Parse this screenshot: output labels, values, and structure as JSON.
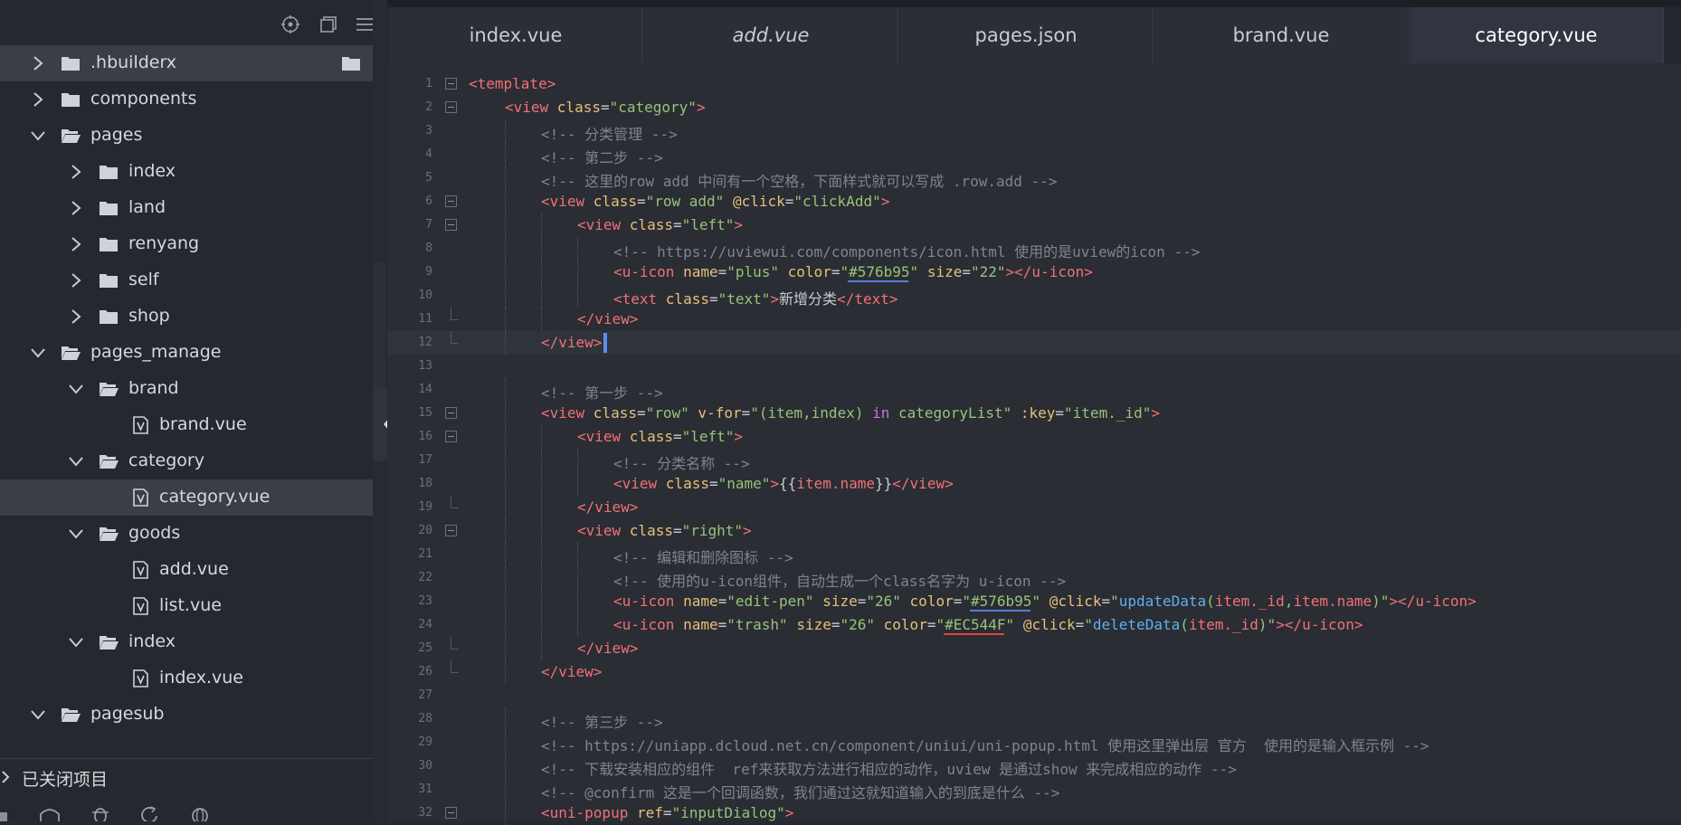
{
  "sidebar": {
    "tree": [
      {
        "label": ".hbuilderx",
        "type": "folder",
        "depth": 0,
        "state": "collapsed",
        "selected": true
      },
      {
        "label": "components",
        "type": "folder",
        "depth": 0,
        "state": "collapsed"
      },
      {
        "label": "pages",
        "type": "folder",
        "depth": 0,
        "state": "expanded"
      },
      {
        "label": "index",
        "type": "folder",
        "depth": 1,
        "state": "collapsed"
      },
      {
        "label": "land",
        "type": "folder",
        "depth": 1,
        "state": "collapsed"
      },
      {
        "label": "renyang",
        "type": "folder",
        "depth": 1,
        "state": "collapsed"
      },
      {
        "label": "self",
        "type": "folder",
        "depth": 1,
        "state": "collapsed"
      },
      {
        "label": "shop",
        "type": "folder",
        "depth": 1,
        "state": "collapsed"
      },
      {
        "label": "pages_manage",
        "type": "folder",
        "depth": 0,
        "state": "expanded"
      },
      {
        "label": "brand",
        "type": "folder",
        "depth": 1,
        "state": "expanded"
      },
      {
        "label": "brand.vue",
        "type": "file",
        "depth": 2
      },
      {
        "label": "category",
        "type": "folder",
        "depth": 1,
        "state": "expanded"
      },
      {
        "label": "category.vue",
        "type": "file",
        "depth": 2,
        "selected": true
      },
      {
        "label": "goods",
        "type": "folder",
        "depth": 1,
        "state": "expanded"
      },
      {
        "label": "add.vue",
        "type": "file",
        "depth": 2
      },
      {
        "label": "list.vue",
        "type": "file",
        "depth": 2
      },
      {
        "label": "index",
        "type": "folder",
        "depth": 1,
        "state": "expanded"
      },
      {
        "label": "index.vue",
        "type": "file",
        "depth": 2
      },
      {
        "label": "pagesub",
        "type": "folder",
        "depth": 0,
        "state": "expanded"
      }
    ],
    "closed_projects_label": "已关闭项目"
  },
  "tabs": [
    {
      "label": "index.vue",
      "italic": false,
      "active": false
    },
    {
      "label": "add.vue",
      "italic": true,
      "active": false
    },
    {
      "label": "pages.json",
      "italic": false,
      "active": false
    },
    {
      "label": "brand.vue",
      "italic": false,
      "active": false
    },
    {
      "label": "category.vue",
      "italic": false,
      "active": true
    }
  ],
  "colors": {
    "background": "#272a30",
    "tag": "#f07178",
    "attribute": "#e6c07b",
    "string": "#98c379",
    "comment": "#7f848e",
    "keyword": "#c678dd",
    "function": "#61afef",
    "underline_blue": "#5b7bd5",
    "underline_red": "#e0443e"
  },
  "code": {
    "current_line": 12,
    "lines": [
      {
        "n": "1",
        "indent": 0,
        "fold": "open",
        "tokens": [
          [
            "t",
            "<template>"
          ]
        ]
      },
      {
        "n": "2",
        "indent": 1,
        "fold": "open",
        "tokens": [
          [
            "t",
            "<view "
          ],
          [
            "a",
            "class"
          ],
          [
            "p",
            "="
          ],
          [
            "s",
            "\"category\""
          ],
          [
            "t",
            ">"
          ]
        ]
      },
      {
        "n": "3",
        "indent": 2,
        "tokens": [
          [
            "c",
            "<!-- 分类管理 -->"
          ]
        ]
      },
      {
        "n": "4",
        "indent": 2,
        "tokens": [
          [
            "c",
            "<!-- 第二步 -->"
          ]
        ]
      },
      {
        "n": "5",
        "indent": 2,
        "tokens": [
          [
            "c",
            "<!-- 这里的row add 中间有一个空格，下面样式就可以写成 .row.add -->"
          ]
        ]
      },
      {
        "n": "6",
        "indent": 2,
        "fold": "open",
        "tokens": [
          [
            "t",
            "<view "
          ],
          [
            "a",
            "class"
          ],
          [
            "p",
            "="
          ],
          [
            "s",
            "\"row add\""
          ],
          [
            "p",
            " "
          ],
          [
            "a",
            "@click"
          ],
          [
            "p",
            "="
          ],
          [
            "s",
            "\"clickAdd\""
          ],
          [
            "t",
            ">"
          ]
        ]
      },
      {
        "n": "7",
        "indent": 3,
        "fold": "open",
        "tokens": [
          [
            "t",
            "<view "
          ],
          [
            "a",
            "class"
          ],
          [
            "p",
            "="
          ],
          [
            "s",
            "\"left\""
          ],
          [
            "t",
            ">"
          ]
        ]
      },
      {
        "n": "8",
        "indent": 4,
        "tokens": [
          [
            "c",
            "<!-- https://uviewui.com/components/icon.html 使用的是uview的icon -->"
          ]
        ]
      },
      {
        "n": "9",
        "indent": 4,
        "tokens": [
          [
            "t",
            "<u-icon "
          ],
          [
            "a",
            "name"
          ],
          [
            "p",
            "="
          ],
          [
            "s",
            "\"plus\""
          ],
          [
            "p",
            " "
          ],
          [
            "a",
            "color"
          ],
          [
            "p",
            "="
          ],
          [
            "s",
            "\"#576b95\""
          ],
          [
            "p",
            " "
          ],
          [
            "a",
            "size"
          ],
          [
            "p",
            "="
          ],
          [
            "s",
            "\"22\""
          ],
          [
            "t",
            "></u-icon>"
          ]
        ]
      },
      {
        "n": "10",
        "indent": 4,
        "tokens": [
          [
            "t",
            "<text "
          ],
          [
            "a",
            "class"
          ],
          [
            "p",
            "="
          ],
          [
            "s",
            "\"text\""
          ],
          [
            "t",
            ">"
          ],
          [
            "p",
            "新增分类"
          ],
          [
            "t",
            "</text>"
          ]
        ]
      },
      {
        "n": "11",
        "indent": 3,
        "fold": "end",
        "tokens": [
          [
            "t",
            "</view>"
          ]
        ]
      },
      {
        "n": "12",
        "indent": 2,
        "fold": "end",
        "tokens": [
          [
            "t",
            "</view>"
          ]
        ]
      },
      {
        "n": "13",
        "indent": 0,
        "tokens": []
      },
      {
        "n": "14",
        "indent": 2,
        "tokens": [
          [
            "c",
            "<!-- 第一步 -->"
          ]
        ]
      },
      {
        "n": "15",
        "indent": 2,
        "fold": "open",
        "tokens": [
          [
            "t",
            "<view "
          ],
          [
            "a",
            "class"
          ],
          [
            "p",
            "="
          ],
          [
            "s",
            "\"row\""
          ],
          [
            "p",
            " "
          ],
          [
            "a",
            "v-for"
          ],
          [
            "p",
            "="
          ],
          [
            "s",
            "\"(item,index) "
          ],
          [
            "k",
            "in"
          ],
          [
            "s",
            " categoryList\""
          ],
          [
            "p",
            " "
          ],
          [
            "a",
            ":key"
          ],
          [
            "p",
            "="
          ],
          [
            "s",
            "\"item._id\""
          ],
          [
            "t",
            ">"
          ]
        ]
      },
      {
        "n": "16",
        "indent": 3,
        "fold": "open",
        "tokens": [
          [
            "t",
            "<view "
          ],
          [
            "a",
            "class"
          ],
          [
            "p",
            "="
          ],
          [
            "s",
            "\"left\""
          ],
          [
            "t",
            ">"
          ]
        ]
      },
      {
        "n": "17",
        "indent": 4,
        "tokens": [
          [
            "c",
            "<!-- 分类名称 -->"
          ]
        ]
      },
      {
        "n": "18",
        "indent": 4,
        "tokens": [
          [
            "t",
            "<view "
          ],
          [
            "a",
            "class"
          ],
          [
            "p",
            "="
          ],
          [
            "s",
            "\"name\""
          ],
          [
            "t",
            ">"
          ],
          [
            "p",
            "{{"
          ],
          [
            "t",
            "item.name"
          ],
          [
            "p",
            "}}"
          ],
          [
            "t",
            "</view>"
          ]
        ]
      },
      {
        "n": "19",
        "indent": 3,
        "fold": "end",
        "tokens": [
          [
            "t",
            "</view>"
          ]
        ]
      },
      {
        "n": "20",
        "indent": 3,
        "fold": "open",
        "tokens": [
          [
            "t",
            "<view "
          ],
          [
            "a",
            "class"
          ],
          [
            "p",
            "="
          ],
          [
            "s",
            "\"right\""
          ],
          [
            "t",
            ">"
          ]
        ]
      },
      {
        "n": "21",
        "indent": 4,
        "tokens": [
          [
            "c",
            "<!-- 编辑和删除图标 -->"
          ]
        ]
      },
      {
        "n": "22",
        "indent": 4,
        "tokens": [
          [
            "c",
            "<!-- 使用的u-icon组件，自动生成一个class名字为 u-icon -->"
          ]
        ]
      },
      {
        "n": "23",
        "indent": 4,
        "tokens": [
          [
            "t",
            "<u-icon "
          ],
          [
            "a",
            "name"
          ],
          [
            "p",
            "="
          ],
          [
            "s",
            "\"edit-pen\""
          ],
          [
            "p",
            " "
          ],
          [
            "a",
            "size"
          ],
          [
            "p",
            "="
          ],
          [
            "s",
            "\"26\""
          ],
          [
            "p",
            " "
          ],
          [
            "a",
            "color"
          ],
          [
            "p",
            "="
          ],
          [
            "s",
            "\"#576b95\""
          ],
          [
            "p",
            " "
          ],
          [
            "a",
            "@click"
          ],
          [
            "p",
            "="
          ],
          [
            "s",
            "\""
          ],
          [
            "f",
            "updateData"
          ],
          [
            "s",
            "("
          ],
          [
            "t",
            "item._id"
          ],
          [
            "s",
            ","
          ],
          [
            "t",
            "item.name"
          ],
          [
            "s",
            ")\""
          ],
          [
            "t",
            "></u-icon>"
          ]
        ]
      },
      {
        "n": "24",
        "indent": 4,
        "tokens": [
          [
            "t",
            "<u-icon "
          ],
          [
            "a",
            "name"
          ],
          [
            "p",
            "="
          ],
          [
            "s",
            "\"trash\""
          ],
          [
            "p",
            " "
          ],
          [
            "a",
            "size"
          ],
          [
            "p",
            "="
          ],
          [
            "s",
            "\"26\""
          ],
          [
            "p",
            " "
          ],
          [
            "a",
            "color"
          ],
          [
            "p",
            "="
          ],
          [
            "s",
            "\"#EC544F\""
          ],
          [
            "p",
            " "
          ],
          [
            "a",
            "@click"
          ],
          [
            "p",
            "="
          ],
          [
            "s",
            "\""
          ],
          [
            "f",
            "deleteData"
          ],
          [
            "s",
            "("
          ],
          [
            "t",
            "item._id"
          ],
          [
            "s",
            ")\""
          ],
          [
            "t",
            "></u-icon>"
          ]
        ]
      },
      {
        "n": "25",
        "indent": 3,
        "fold": "end",
        "tokens": [
          [
            "t",
            "</view>"
          ]
        ]
      },
      {
        "n": "26",
        "indent": 2,
        "fold": "end",
        "tokens": [
          [
            "t",
            "</view>"
          ]
        ]
      },
      {
        "n": "27",
        "indent": 0,
        "tokens": []
      },
      {
        "n": "28",
        "indent": 2,
        "tokens": [
          [
            "c",
            "<!-- 第三步 -->"
          ]
        ]
      },
      {
        "n": "29",
        "indent": 2,
        "tokens": [
          [
            "c",
            "<!-- https://uniapp.dcloud.net.cn/component/uniui/uni-popup.html 使用这里弹出层 官方  使用的是输入框示例 -->"
          ]
        ]
      },
      {
        "n": "30",
        "indent": 2,
        "tokens": [
          [
            "c",
            "<!-- 下载安装相应的组件  ref来获取方法进行相应的动作，uview 是通过show 来完成相应的动作 -->"
          ]
        ]
      },
      {
        "n": "31",
        "indent": 2,
        "tokens": [
          [
            "c",
            "<!-- @confirm 这是一个回调函数，我们通过这就知道输入的到底是什么 -->"
          ]
        ]
      },
      {
        "n": "32",
        "indent": 2,
        "fold": "open",
        "tokens": [
          [
            "t",
            "<uni-popup "
          ],
          [
            "a",
            "ref"
          ],
          [
            "p",
            "="
          ],
          [
            "s",
            "\"inputDialog\""
          ],
          [
            "t",
            ">"
          ]
        ]
      }
    ]
  },
  "bottom_icons": [
    "git-icon",
    "bug-icon",
    "refresh-icon",
    "globe-icon"
  ],
  "top_icons": [
    "target-icon",
    "copy-icon",
    "menu-icon"
  ]
}
